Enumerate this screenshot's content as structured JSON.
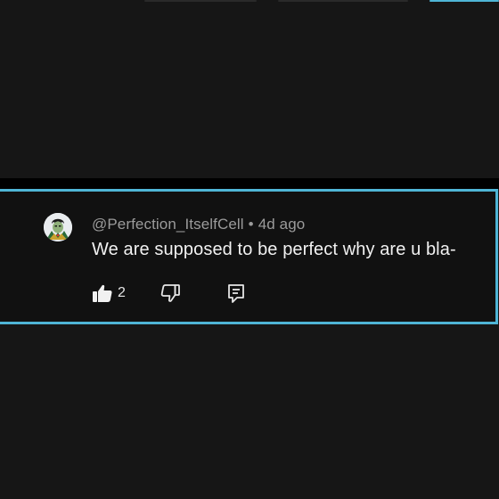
{
  "comment": {
    "author": "@Perfection_ItselfCell",
    "separator": "•",
    "timestamp": "4d ago",
    "text": "We are supposed to be perfect why are u bla-",
    "like_count": "2"
  },
  "icons": {
    "avatar": "avatar-image",
    "like": "thumbs-up-icon",
    "dislike": "thumbs-down-icon",
    "reply": "reply-comment-icon"
  },
  "colors": {
    "background": "#161616",
    "card_background": "#111111",
    "highlight_border": "#4fb5d6",
    "author_text": "#9b9b9b",
    "body_text": "#f1f1f1"
  }
}
